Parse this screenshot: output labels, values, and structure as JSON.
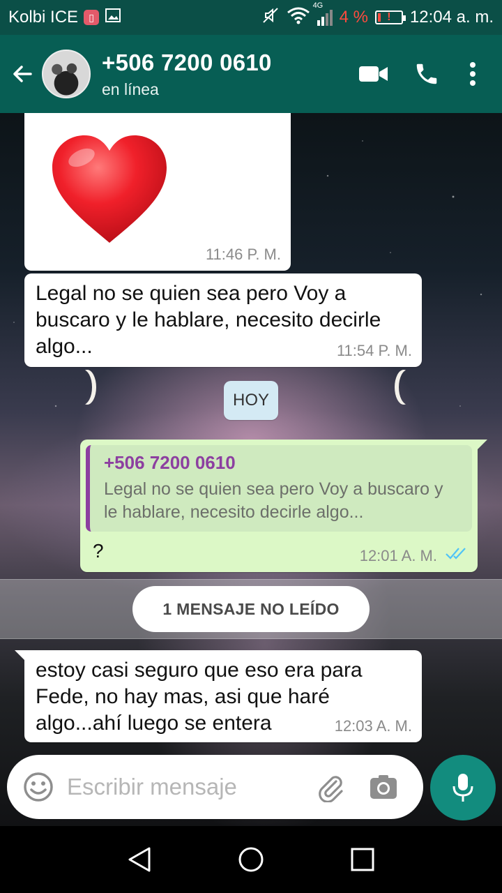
{
  "status_bar": {
    "carrier": "Kolbi ICE",
    "network": "4G",
    "battery_percent": "4 %",
    "time": "12:04 a. m."
  },
  "header": {
    "contact_name": "+506 7200 0610",
    "contact_status": "en línea"
  },
  "messages": [
    {
      "type": "sticker",
      "direction": "in",
      "icon": "red-heart",
      "time": "11:46 P. M."
    },
    {
      "type": "text",
      "direction": "in",
      "text": "Legal no se quien sea pero Voy a buscaro y le hablare, necesito decirle algo...",
      "time": "11:54 P. M."
    },
    {
      "type": "reply",
      "direction": "out",
      "quoted_author": "+506 7200 0610",
      "quoted_text": "Legal no se quien sea pero Voy a buscaro y le hablare, necesito decirle algo...",
      "text": "?",
      "time": "12:01 A. M.",
      "status": "read"
    },
    {
      "type": "text",
      "direction": "in",
      "text": "estoy casi seguro que eso era para Fede, no hay mas, asi que haré algo...ahí luego se entera",
      "time": "12:03 A. M."
    }
  ],
  "day_divider": "HOY",
  "unread_divider": "1 MENSAJE NO LEÍDO",
  "composer": {
    "placeholder": "Escribir mensaje"
  },
  "colors": {
    "header": "#075e54",
    "status_bar": "#0b4f47",
    "outgoing_bubble": "#dcf8c6",
    "incoming_bubble": "#ffffff",
    "quote_accent": "#8c3fa0",
    "read_ticks": "#4fc3f7",
    "mic_button": "#128c7e"
  }
}
